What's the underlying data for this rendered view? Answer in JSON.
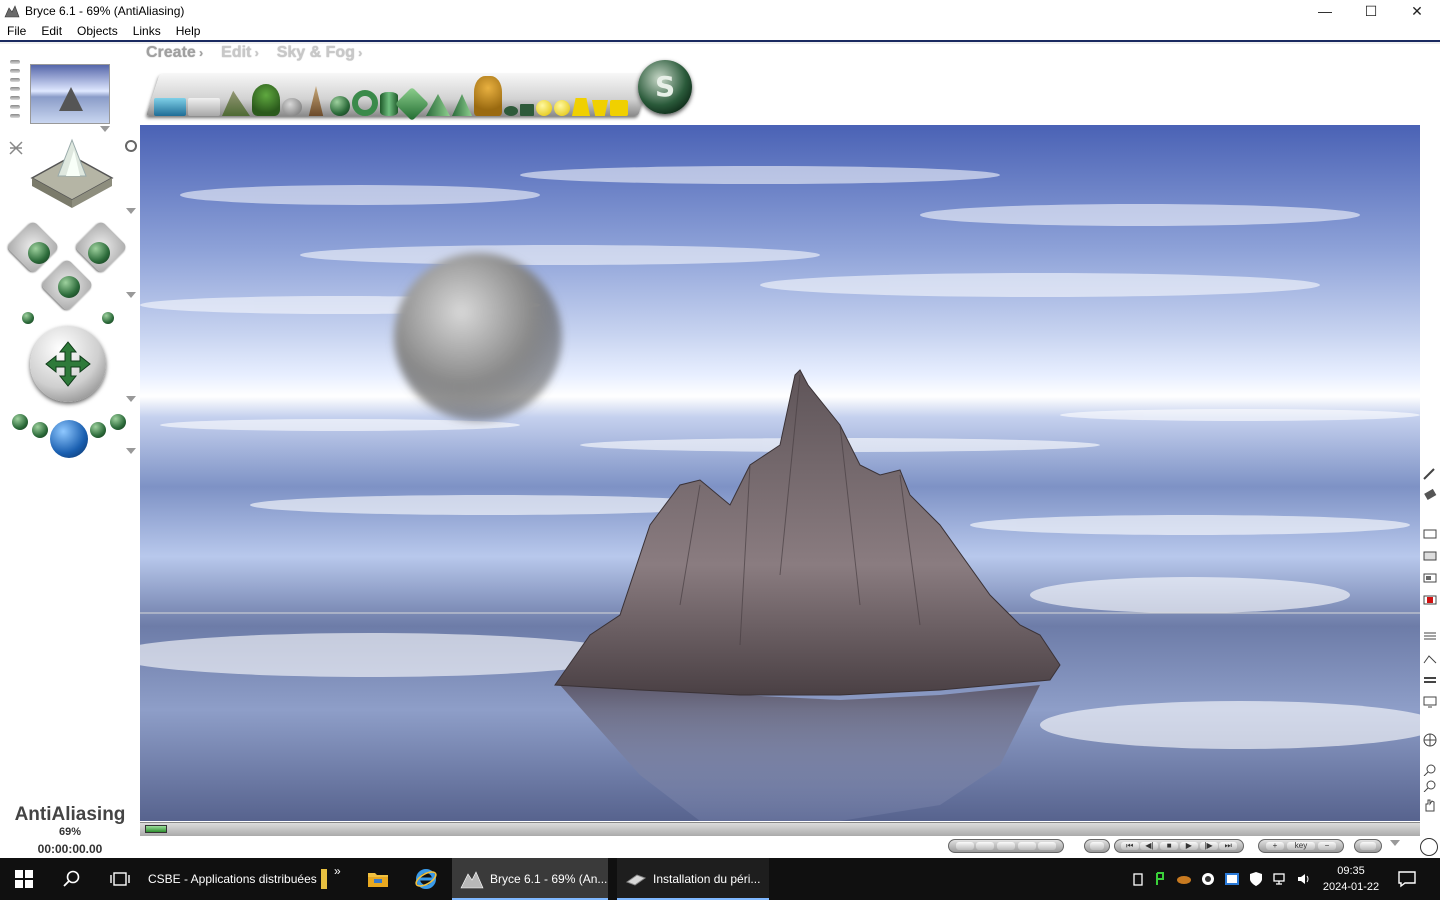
{
  "window": {
    "title": "Bryce 6.1 - 69% (AntiAliasing)",
    "controls": {
      "minimize": "—",
      "maximize": "☐",
      "close": "✕"
    }
  },
  "menu": {
    "items": [
      "File",
      "Edit",
      "Objects",
      "Links",
      "Help"
    ]
  },
  "palette": {
    "tabs": [
      "Create",
      "Edit",
      "Sky & Fog"
    ],
    "active_tab": "Create",
    "create_items": [
      "water-plane-icon",
      "terrain-plane-icon",
      "terrain-icon",
      "tree-icon",
      "rock-icon",
      "symmetrical-lattice-icon",
      "stone-icon",
      "torus-icon",
      "cylinder-icon",
      "cube-icon",
      "pyramid-icon",
      "cone-icon",
      "human-figure-icon",
      "disc-icon",
      "square-icon",
      "light-sphere-icon",
      "radial-light-icon",
      "spotlight-icon",
      "square-spotlight-icon",
      "parallel-light-icon"
    ]
  },
  "status": {
    "mode": "AntiAliasing",
    "percent": "69%",
    "time": "00:00:00.00",
    "progress": 0.69
  },
  "colors": {
    "title_bg": "#ffffff",
    "app_bg": "#ffffff",
    "taskbar_bg": "#101010",
    "accent": "#7fb8ff",
    "sky_top": "#4a62b5",
    "horizon": "#ffffff",
    "terrain": "#7d6e72"
  },
  "taskbar": {
    "toolbar_label": "CSBE - Applications distribuées",
    "toolbar_chevron": "»",
    "apps": [
      {
        "name": "File Explorer",
        "icon": "folder-icon"
      },
      {
        "name": "Internet Explorer",
        "icon": "ie-icon"
      },
      {
        "label": "Bryce 6.1 - 69% (An...",
        "icon": "bryce-icon",
        "active": true
      },
      {
        "label": "Installation du péri...",
        "icon": "device-install-icon",
        "active": false
      }
    ],
    "clock_time": "09:35",
    "clock_date": "2024-01-22"
  },
  "animation_controls": {
    "groups": [
      "frame-selector",
      "playback",
      "keyframe",
      "options"
    ],
    "playback": [
      "⏮",
      "◀|",
      "■",
      "▶",
      "|▶",
      "⏭"
    ],
    "keyframe": [
      "+",
      "key",
      "−"
    ]
  }
}
